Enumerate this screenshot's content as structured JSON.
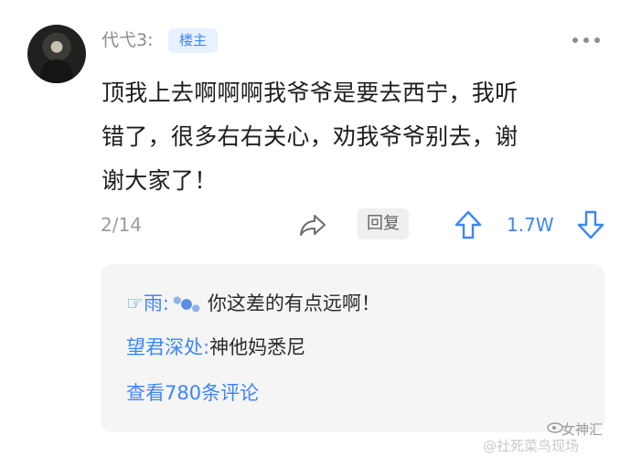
{
  "post": {
    "username": "代弋3:",
    "op_badge": "楼主",
    "text": "顶我上去啊啊啊我爷爷是要去西宁，我听\n错了，很多右右关心，劝我爷爷别去，谢\n谢大家了！",
    "page_indicator": "2/14",
    "reply_label": "回复",
    "upvote_count": "1.7W"
  },
  "comments": [
    {
      "author": "☞雨:",
      "text": "你这差的有点远啊！"
    },
    {
      "author": "望君深处:",
      "text": "神他妈悉尼"
    }
  ],
  "view_all_comments": "查看780条评论",
  "watermark": {
    "brand": "女神汇",
    "line": "@社死菜鸟现场"
  },
  "colors": {
    "accent": "#3d86f6",
    "badge_bg": "#e8f1ff",
    "comment_box_bg": "#f5f5f5"
  },
  "icons": [
    "avatar",
    "more-icon",
    "share-icon",
    "upvote-icon",
    "downvote-icon",
    "weibo-icon"
  ]
}
